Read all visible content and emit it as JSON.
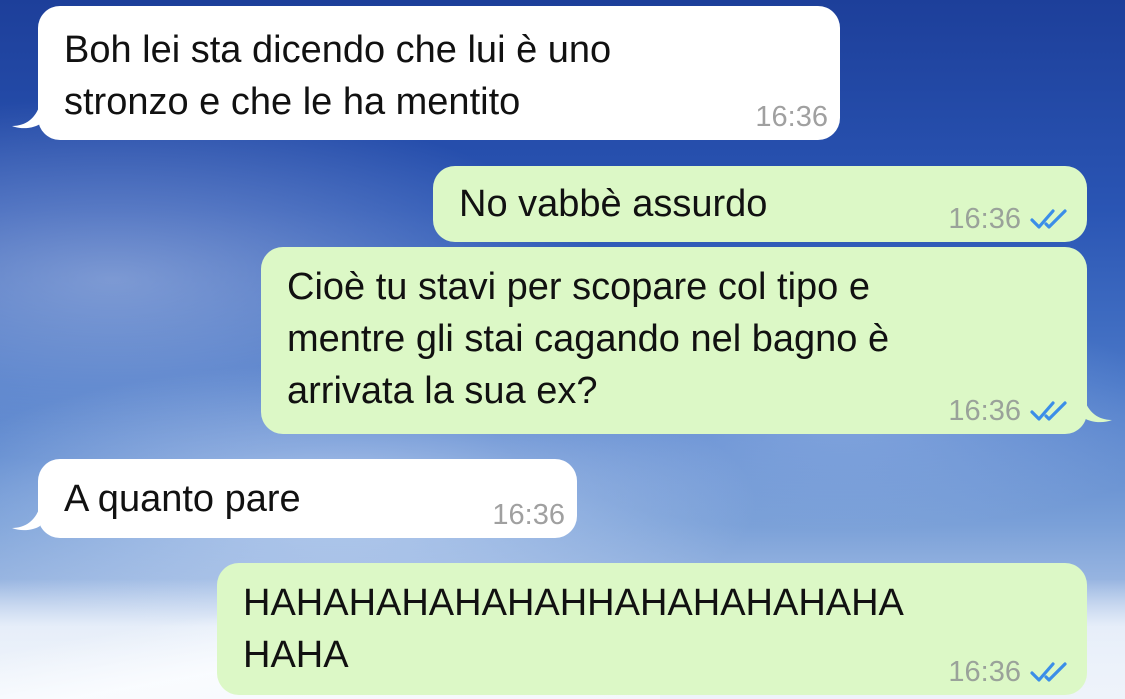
{
  "chat": {
    "messages": [
      {
        "direction": "incoming",
        "text": "Boh lei sta dicendo che lui è uno\nstronzo e che le ha mentito",
        "time": "16:36"
      },
      {
        "direction": "outgoing",
        "text": "No vabbè assurdo",
        "time": "16:36",
        "status": "double-check-icon"
      },
      {
        "direction": "outgoing",
        "text": "Cioè tu stavi per scopare col tipo e\nmentre gli stai cagando nel bagno è\narrivata la sua ex?",
        "time": "16:36",
        "status": "double-check-icon"
      },
      {
        "direction": "incoming",
        "text": "A quanto pare",
        "time": "16:36"
      },
      {
        "direction": "outgoing",
        "text": "HAHAHAHAHAHAHHAHAHAHAHAHA\nHAHA",
        "time": "16:36",
        "status": "double-check-icon"
      }
    ]
  },
  "colors": {
    "incoming_bubble": "#ffffff",
    "outgoing_bubble": "#dcf8c6",
    "timestamp": "#9aa29a",
    "read_tick": "#3b8ee8"
  }
}
